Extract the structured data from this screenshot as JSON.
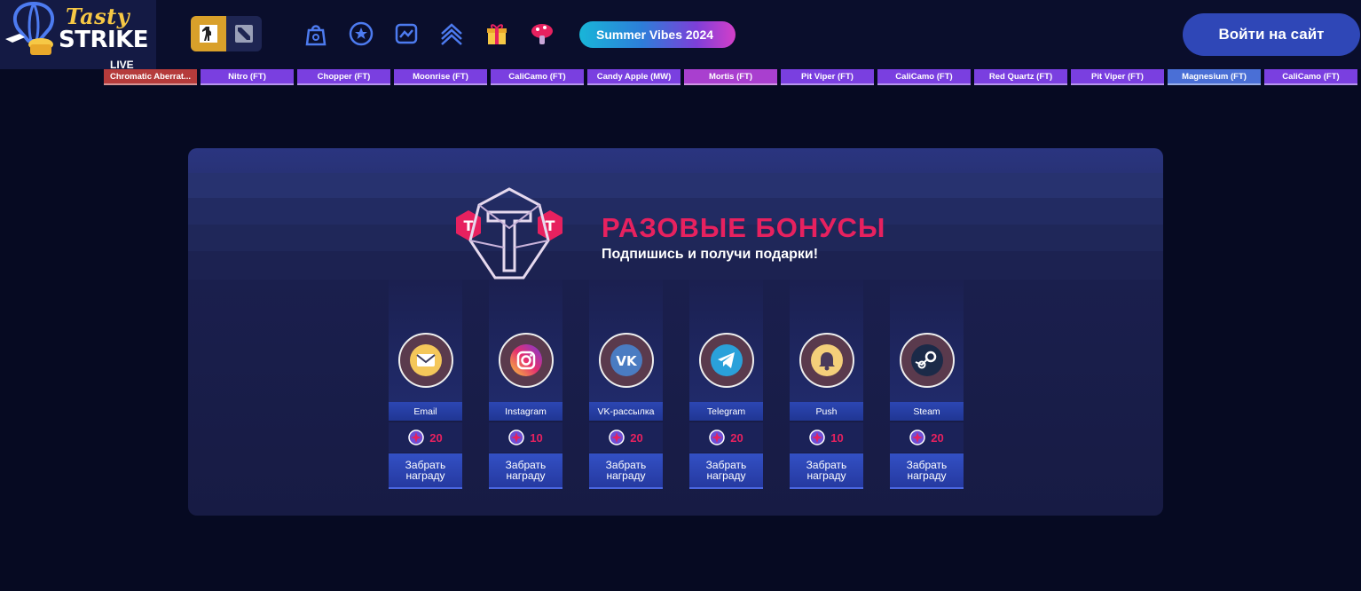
{
  "header": {
    "logo_top": "Tasty",
    "logo_bottom": "STRIKE",
    "live_label": "LIVE",
    "games": [
      {
        "name": "cs-go-icon",
        "active": true
      },
      {
        "name": "dota-icon",
        "active": false
      }
    ],
    "nav_icons": [
      "bag-icon",
      "star-icon",
      "upgrade-icon",
      "rank-icon",
      "gift-icon",
      "mushroom-icon"
    ],
    "event_label": "Summer Vibes 2024",
    "login_label": "Войти на сайт"
  },
  "ticker": {
    "items": [
      {
        "label": "Chromatic Aberrat...",
        "color": "#b53b3b"
      },
      {
        "label": "Nitro (FT)",
        "color": "#7a3fe0"
      },
      {
        "label": "Chopper (FT)",
        "color": "#7a3fe0"
      },
      {
        "label": "Moonrise (FT)",
        "color": "#7a3fe0"
      },
      {
        "label": "CaliCamo (FT)",
        "color": "#7a3fe0"
      },
      {
        "label": "Candy Apple (MW)",
        "color": "#7a3fe0"
      },
      {
        "label": "Mortis (FT)",
        "color": "#a93fcf"
      },
      {
        "label": "Pit Viper (FT)",
        "color": "#7a3fe0"
      },
      {
        "label": "CaliCamo (FT)",
        "color": "#7a3fe0"
      },
      {
        "label": "Red Quartz (FT)",
        "color": "#7a3fe0"
      },
      {
        "label": "Pit Viper (FT)",
        "color": "#7a3fe0"
      },
      {
        "label": "Magnesium (FT)",
        "color": "#4a6fd6"
      },
      {
        "label": "CaliCamo (FT)",
        "color": "#7a3fe0"
      }
    ]
  },
  "bonus": {
    "title": "РАЗОВЫЕ БОНУСЫ",
    "subtitle": "Подпишись и получи подарки!",
    "claim_label": "Забрать награду",
    "cards": [
      {
        "name": "Email",
        "reward": "20",
        "icon": "email-icon"
      },
      {
        "name": "Instagram",
        "reward": "10",
        "icon": "instagram-icon"
      },
      {
        "name": "VK-рассылка",
        "reward": "20",
        "icon": "vk-icon"
      },
      {
        "name": "Telegram",
        "reward": "20",
        "icon": "telegram-icon"
      },
      {
        "name": "Push",
        "reward": "10",
        "icon": "bell-icon"
      },
      {
        "name": "Steam",
        "reward": "20",
        "icon": "steam-icon"
      }
    ]
  },
  "colors": {
    "accent_pink": "#e7215f",
    "login_blue": "#2f47b7",
    "background": "#060a22"
  }
}
